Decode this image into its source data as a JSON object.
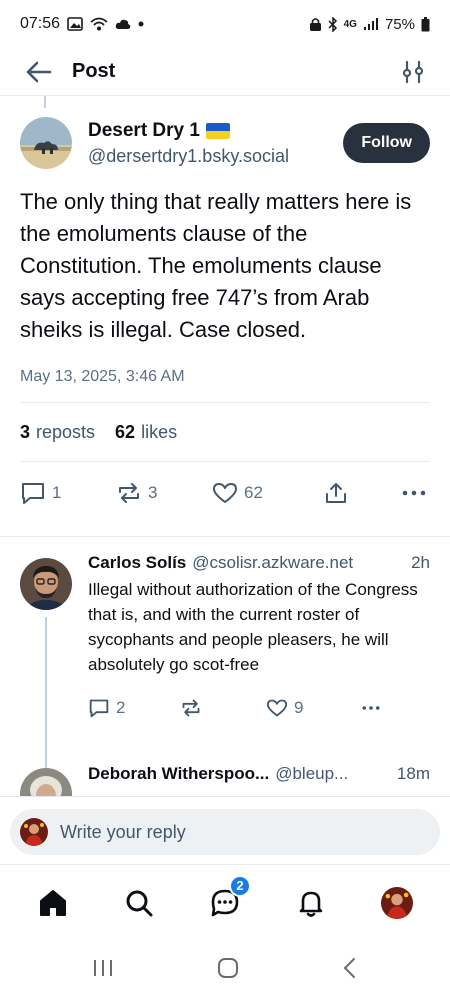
{
  "status_bar": {
    "time": "07:56",
    "network": "4G",
    "battery": "75%"
  },
  "header": {
    "title": "Post"
  },
  "post": {
    "author": {
      "display_name": "Desert Dry 1",
      "handle": "@dersertdry1.bsky.social"
    },
    "follow_label": "Follow",
    "text": "The only thing that really matters here is the emoluments clause of the Constitution. The emoluments clause says accepting free 747’s from Arab sheiks is illegal. Case closed.",
    "timestamp": "May 13, 2025, 3:46 AM",
    "stats": {
      "reposts_count": "3",
      "reposts_label": "reposts",
      "likes_count": "62",
      "likes_label": "likes"
    },
    "actions": {
      "replies": "1",
      "reposts": "3",
      "likes": "62"
    }
  },
  "replies": [
    {
      "display_name": "Carlos Solís",
      "handle": "@csolisr.azkware.net",
      "time": "2h",
      "text": "Illegal without authorization of the Congress that is, and with the current roster of sycophants and people pleasers, he will absolutely go scot-free",
      "reply_count": "2",
      "like_count": "9"
    },
    {
      "display_name": "Deborah Witherspoo...",
      "handle": "@bleup...",
      "time": "18m"
    }
  ],
  "compose": {
    "placeholder": "Write your reply"
  },
  "nav": {
    "chat_badge": "2"
  },
  "colors": {
    "accent": "#1a7ae6",
    "follow_bg": "#28323e",
    "muted_text": "#42576c",
    "ukraine_blue": "#1a5cc7",
    "ukraine_yellow": "#f5d020"
  },
  "icons": [
    "back-arrow-icon",
    "filter-icon",
    "reply-icon",
    "repost-icon",
    "heart-icon",
    "share-icon",
    "more-icon",
    "home-icon",
    "search-icon",
    "chat-icon",
    "bell-icon"
  ]
}
